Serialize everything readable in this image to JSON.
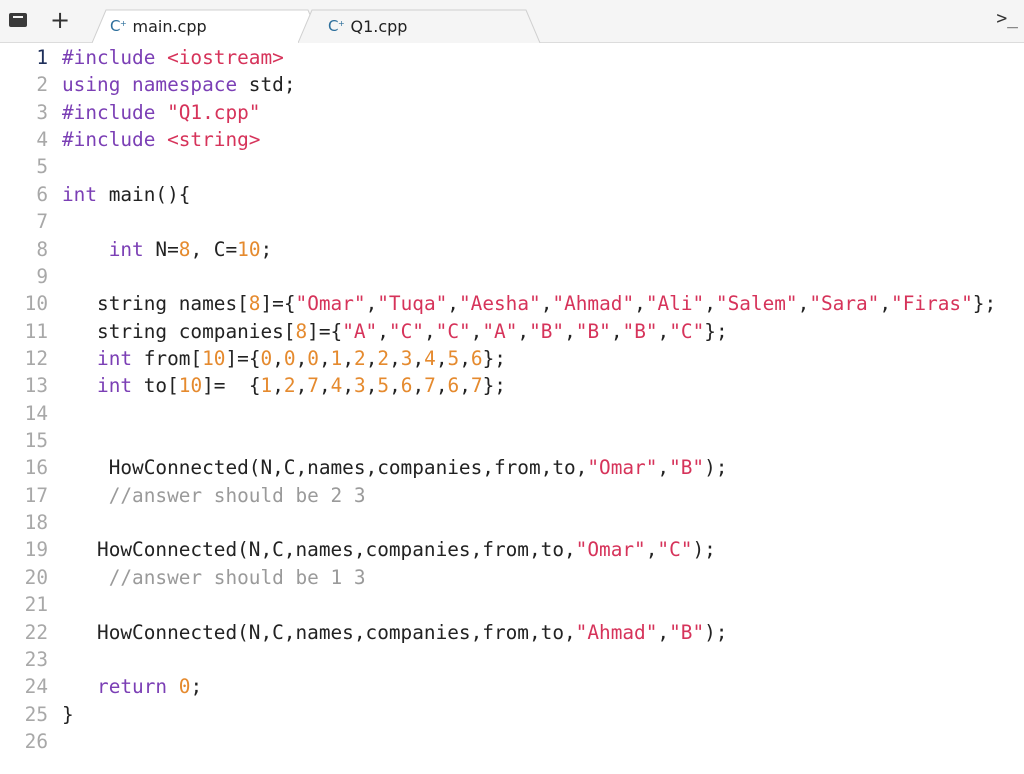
{
  "tabbar": {
    "sidebar_toggle_icon": "sidebar-icon",
    "new_tab_label": "+",
    "terminal_label": ">_",
    "tabs": [
      {
        "label": "main.cpp",
        "icon": "C+",
        "active": true
      },
      {
        "label": "Q1.cpp",
        "icon": "C+",
        "active": false
      }
    ]
  },
  "editor": {
    "active_line": 1,
    "lines": [
      {
        "n": "1",
        "tokens": [
          [
            "pp",
            "#include "
          ],
          [
            "str",
            "<iostream>"
          ]
        ]
      },
      {
        "n": "2",
        "tokens": [
          [
            "kw",
            "using namespace "
          ],
          [
            "plain",
            "std;"
          ]
        ]
      },
      {
        "n": "3",
        "tokens": [
          [
            "pp",
            "#include "
          ],
          [
            "str",
            "\"Q1.cpp\""
          ]
        ]
      },
      {
        "n": "4",
        "tokens": [
          [
            "pp",
            "#include "
          ],
          [
            "str",
            "<string>"
          ]
        ]
      },
      {
        "n": "5",
        "tokens": []
      },
      {
        "n": "6",
        "tokens": [
          [
            "kw",
            "int "
          ],
          [
            "plain",
            "main(){"
          ]
        ]
      },
      {
        "n": "7",
        "tokens": []
      },
      {
        "n": "8",
        "tokens": [
          [
            "plain",
            "    "
          ],
          [
            "kw",
            "int "
          ],
          [
            "plain",
            "N="
          ],
          [
            "num",
            "8"
          ],
          [
            "plain",
            ", C="
          ],
          [
            "num",
            "10"
          ],
          [
            "plain",
            ";"
          ]
        ]
      },
      {
        "n": "9",
        "tokens": []
      },
      {
        "n": "10",
        "tokens": [
          [
            "plain",
            "   string names["
          ],
          [
            "num",
            "8"
          ],
          [
            "plain",
            "]={"
          ],
          [
            "str",
            "\"Omar\""
          ],
          [
            "plain",
            ","
          ],
          [
            "str",
            "\"Tuqa\""
          ],
          [
            "plain",
            ","
          ],
          [
            "str",
            "\"Aesha\""
          ],
          [
            "plain",
            ","
          ],
          [
            "str",
            "\"Ahmad\""
          ],
          [
            "plain",
            ","
          ],
          [
            "str",
            "\"Ali\""
          ],
          [
            "plain",
            ","
          ],
          [
            "str",
            "\"Salem\""
          ],
          [
            "plain",
            ","
          ],
          [
            "str",
            "\"Sara\""
          ],
          [
            "plain",
            ","
          ],
          [
            "str",
            "\"Firas\""
          ],
          [
            "plain",
            "};"
          ]
        ]
      },
      {
        "n": "11",
        "tokens": [
          [
            "plain",
            "   string companies["
          ],
          [
            "num",
            "8"
          ],
          [
            "plain",
            "]={"
          ],
          [
            "str",
            "\"A\""
          ],
          [
            "plain",
            ","
          ],
          [
            "str",
            "\"C\""
          ],
          [
            "plain",
            ","
          ],
          [
            "str",
            "\"C\""
          ],
          [
            "plain",
            ","
          ],
          [
            "str",
            "\"A\""
          ],
          [
            "plain",
            ","
          ],
          [
            "str",
            "\"B\""
          ],
          [
            "plain",
            ","
          ],
          [
            "str",
            "\"B\""
          ],
          [
            "plain",
            ","
          ],
          [
            "str",
            "\"B\""
          ],
          [
            "plain",
            ","
          ],
          [
            "str",
            "\"C\""
          ],
          [
            "plain",
            "};"
          ]
        ]
      },
      {
        "n": "12",
        "tokens": [
          [
            "plain",
            "   "
          ],
          [
            "kw",
            "int "
          ],
          [
            "plain",
            "from["
          ],
          [
            "num",
            "10"
          ],
          [
            "plain",
            "]={"
          ],
          [
            "num",
            "0"
          ],
          [
            "plain",
            ","
          ],
          [
            "num",
            "0"
          ],
          [
            "plain",
            ","
          ],
          [
            "num",
            "0"
          ],
          [
            "plain",
            ","
          ],
          [
            "num",
            "1"
          ],
          [
            "plain",
            ","
          ],
          [
            "num",
            "2"
          ],
          [
            "plain",
            ","
          ],
          [
            "num",
            "2"
          ],
          [
            "plain",
            ","
          ],
          [
            "num",
            "3"
          ],
          [
            "plain",
            ","
          ],
          [
            "num",
            "4"
          ],
          [
            "plain",
            ","
          ],
          [
            "num",
            "5"
          ],
          [
            "plain",
            ","
          ],
          [
            "num",
            "6"
          ],
          [
            "plain",
            "};"
          ]
        ]
      },
      {
        "n": "13",
        "tokens": [
          [
            "plain",
            "   "
          ],
          [
            "kw",
            "int "
          ],
          [
            "plain",
            "to["
          ],
          [
            "num",
            "10"
          ],
          [
            "plain",
            "]=  {"
          ],
          [
            "num",
            "1"
          ],
          [
            "plain",
            ","
          ],
          [
            "num",
            "2"
          ],
          [
            "plain",
            ","
          ],
          [
            "num",
            "7"
          ],
          [
            "plain",
            ","
          ],
          [
            "num",
            "4"
          ],
          [
            "plain",
            ","
          ],
          [
            "num",
            "3"
          ],
          [
            "plain",
            ","
          ],
          [
            "num",
            "5"
          ],
          [
            "plain",
            ","
          ],
          [
            "num",
            "6"
          ],
          [
            "plain",
            ","
          ],
          [
            "num",
            "7"
          ],
          [
            "plain",
            ","
          ],
          [
            "num",
            "6"
          ],
          [
            "plain",
            ","
          ],
          [
            "num",
            "7"
          ],
          [
            "plain",
            "};"
          ]
        ]
      },
      {
        "n": "14",
        "tokens": []
      },
      {
        "n": "15",
        "tokens": []
      },
      {
        "n": "16",
        "tokens": [
          [
            "plain",
            "    HowConnected(N,C,names,companies,from,to,"
          ],
          [
            "str",
            "\"Omar\""
          ],
          [
            "plain",
            ","
          ],
          [
            "str",
            "\"B\""
          ],
          [
            "plain",
            ");"
          ]
        ]
      },
      {
        "n": "17",
        "tokens": [
          [
            "plain",
            "    "
          ],
          [
            "cm",
            "//answer should be 2 3"
          ]
        ]
      },
      {
        "n": "18",
        "tokens": []
      },
      {
        "n": "19",
        "tokens": [
          [
            "plain",
            "   HowConnected(N,C,names,companies,from,to,"
          ],
          [
            "str",
            "\"Omar\""
          ],
          [
            "plain",
            ","
          ],
          [
            "str",
            "\"C\""
          ],
          [
            "plain",
            ");"
          ]
        ]
      },
      {
        "n": "20",
        "tokens": [
          [
            "plain",
            "    "
          ],
          [
            "cm",
            "//answer should be 1 3"
          ]
        ]
      },
      {
        "n": "21",
        "tokens": []
      },
      {
        "n": "22",
        "tokens": [
          [
            "plain",
            "   HowConnected(N,C,names,companies,from,to,"
          ],
          [
            "str",
            "\"Ahmad\""
          ],
          [
            "plain",
            ","
          ],
          [
            "str",
            "\"B\""
          ],
          [
            "plain",
            ");"
          ]
        ]
      },
      {
        "n": "23",
        "tokens": []
      },
      {
        "n": "24",
        "tokens": [
          [
            "plain",
            "   "
          ],
          [
            "kw",
            "return "
          ],
          [
            "num",
            "0"
          ],
          [
            "plain",
            ";"
          ]
        ]
      },
      {
        "n": "25",
        "tokens": [
          [
            "plain",
            "}"
          ]
        ]
      },
      {
        "n": "26",
        "tokens": []
      }
    ]
  },
  "colors": {
    "keyword": "#7b3fb5",
    "string": "#d6335a",
    "number": "#e58a2e",
    "comment": "#9a9a9a",
    "line_number": "#a8a8a8",
    "active_line_number": "#1e2f5a",
    "tab_icon": "#2c6e9b"
  }
}
